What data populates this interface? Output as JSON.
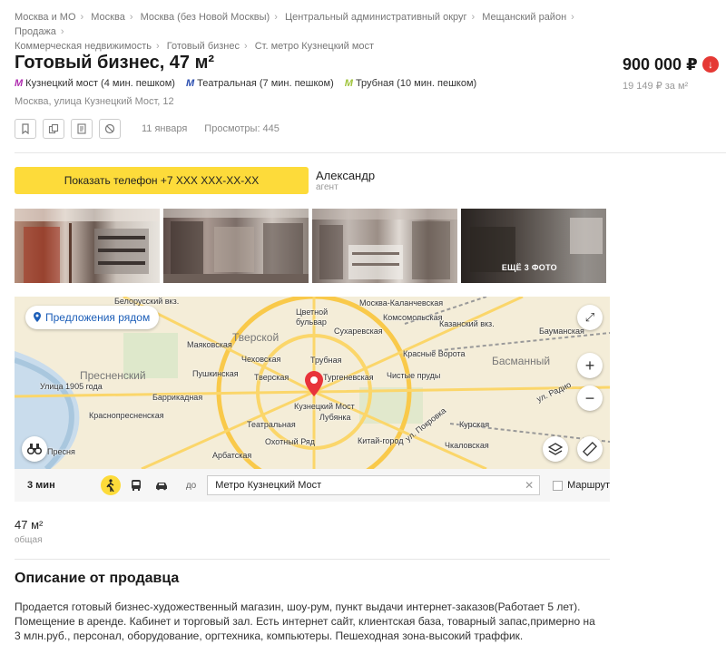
{
  "breadcrumbs": [
    "Москва и МО",
    "Москва",
    "Москва (без Новой Москвы)",
    "Центральный административный округ",
    "Мещанский район",
    "Продажа",
    "Коммерческая недвижимость",
    "Готовый бизнес",
    "Ст. метро Кузнецкий мост"
  ],
  "title": "Готовый бизнес, 47 м²",
  "metro": [
    {
      "name": "Кузнецкий мост (4 мин. пешком)",
      "color": "#b02cb0"
    },
    {
      "name": "Театральная (7 мин. пешком)",
      "color": "#2c4fb0"
    },
    {
      "name": "Трубная (10 мин. пешком)",
      "color": "#9fc43a"
    }
  ],
  "metro_logo": "M",
  "address": "Москва, улица Кузнецкий Мост, 12",
  "price": "900 000 ₽",
  "price_per_m2": "19 149 ₽ за м²",
  "price_trend_icon": "↓",
  "meta": {
    "date": "11 января",
    "views": "Просмотры: 445"
  },
  "contact": {
    "phone_button": "Показать телефон +7 XXX XXX-XX-XX",
    "name": "Александр",
    "role": "агент"
  },
  "photos": {
    "more_label": "ЕЩЁ 3 ФОТО"
  },
  "map": {
    "nearby_button": "Предложения рядом",
    "labels": [
      "Белорусский вкз.",
      "Цветной бульвар",
      "Москва-Каланчевская",
      "Комсомольская",
      "Казанский вкз.",
      "Сухаревская",
      "Бауманская",
      "Тверской",
      "Маяковская",
      "Красные Ворота",
      "Пресненский",
      "Чеховская",
      "Трубная",
      "Басманный",
      "Пушкинская",
      "Тверская",
      "Тургеневская",
      "Чистые пруды",
      "Улица 1905 года",
      "Баррикадная",
      "Кузнецкий Мост",
      "Краснопресненская",
      "Лубянка",
      "Курская",
      "Театральная",
      "Охотный Ряд",
      "Китай-город",
      "Чкаловская",
      "Арбатская",
      "Пресня",
      "ул. Покровка",
      "ул. Радио"
    ]
  },
  "route": {
    "time": "3 мин",
    "to_label": "до",
    "destination": "Метро Кузнецкий Мост",
    "checkbox_label": "Маршрут"
  },
  "area": {
    "value": "47 м²",
    "label": "общая"
  },
  "description": {
    "heading": "Описание от продавца",
    "text": "Продается готовый бизнес-художественный магазин, шоу-рум, пункт выдачи интернет-заказов(Работает 5 лет). Помещение в аренде. Кабинет и торговый зал. Есть интернет сайт, клиентская база, товарный запас,примерно на 3 млн.руб., персонал, оборудование, оргтехника, компьютеры. Пешеходная зона-высокий траффик."
  },
  "icons": [
    "bookmark-icon",
    "copy-icon",
    "document-icon",
    "block-icon",
    "map-pin-icon",
    "expand-icon",
    "zoom-in-icon",
    "zoom-out-icon",
    "binoculars-icon",
    "layers-icon",
    "ruler-icon",
    "walk-icon",
    "bus-icon",
    "car-icon"
  ]
}
